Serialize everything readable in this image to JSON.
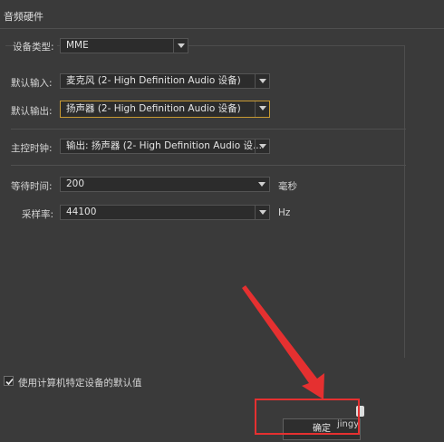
{
  "section": {
    "title": "音频硬件"
  },
  "device_type": {
    "label": "设备类型:",
    "value": "MME"
  },
  "default_input": {
    "label": "默认输入:",
    "value": "麦克风 (2- High Definition Audio 设备)"
  },
  "default_output": {
    "label": "默认输出:",
    "value": "扬声器 (2- High Definition Audio 设备)"
  },
  "master_clock": {
    "label": "主控时钟:",
    "value": "输出: 扬声器 (2- High Definition Audio 设..."
  },
  "latency": {
    "label": "等待时间:",
    "value": "200",
    "unit": "毫秒"
  },
  "sample_rate": {
    "label": "采样率:",
    "value": "44100",
    "unit": "Hz"
  },
  "use_defaults": {
    "label": "使用计算机特定设备的默认值",
    "checked": true
  },
  "ok_button": {
    "label": "确定"
  },
  "watermark": {
    "text": "jingy"
  },
  "colors": {
    "annotation": "#e53030",
    "focus_border": "#c89a32",
    "background": "#3a3a3a"
  },
  "icons": {
    "dropdown": "chevron-down-icon",
    "check": "checkmark-icon"
  }
}
